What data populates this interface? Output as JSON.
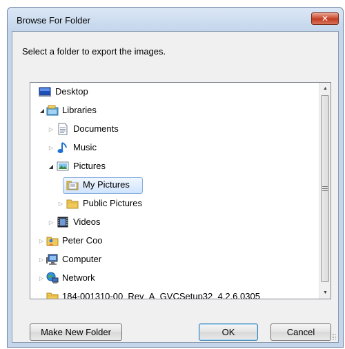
{
  "dialog": {
    "title": "Browse For Folder",
    "close_symbol": "✕",
    "instruction": "Select a folder to export the images."
  },
  "tree": {
    "items": [
      {
        "label": "Desktop",
        "icon": "desktop-icon",
        "expander": "none",
        "selected": false
      },
      {
        "label": "Libraries",
        "icon": "libraries-icon",
        "expander": "expanded",
        "selected": false
      },
      {
        "label": "Documents",
        "icon": "documents-library-icon",
        "expander": "collapsed",
        "selected": false
      },
      {
        "label": "Music",
        "icon": "music-library-icon",
        "expander": "collapsed",
        "selected": false
      },
      {
        "label": "Pictures",
        "icon": "pictures-library-icon",
        "expander": "expanded",
        "selected": false
      },
      {
        "label": "My Pictures",
        "icon": "folder-icon",
        "expander": "none",
        "selected": true
      },
      {
        "label": "Public Pictures",
        "icon": "folder-icon",
        "expander": "collapsed",
        "selected": false
      },
      {
        "label": "Videos",
        "icon": "videos-library-icon",
        "expander": "collapsed",
        "selected": false
      },
      {
        "label": "Peter Coo",
        "icon": "user-folder-icon",
        "expander": "collapsed",
        "selected": false
      },
      {
        "label": "Computer",
        "icon": "computer-icon",
        "expander": "collapsed",
        "selected": false
      },
      {
        "label": "Network",
        "icon": "network-icon",
        "expander": "collapsed",
        "selected": false
      },
      {
        "label": "184-001310-00_Rev_A_GVCSetup32_4.2.6.0305",
        "icon": "folder-icon",
        "expander": "none",
        "selected": false
      }
    ]
  },
  "buttons": {
    "make_new_folder": "Make New Folder",
    "ok": "OK",
    "cancel": "Cancel"
  },
  "colors": {
    "selection_border": "#84acdd",
    "title_bar": "#c4d6ec",
    "close_button": "#c9462c"
  }
}
